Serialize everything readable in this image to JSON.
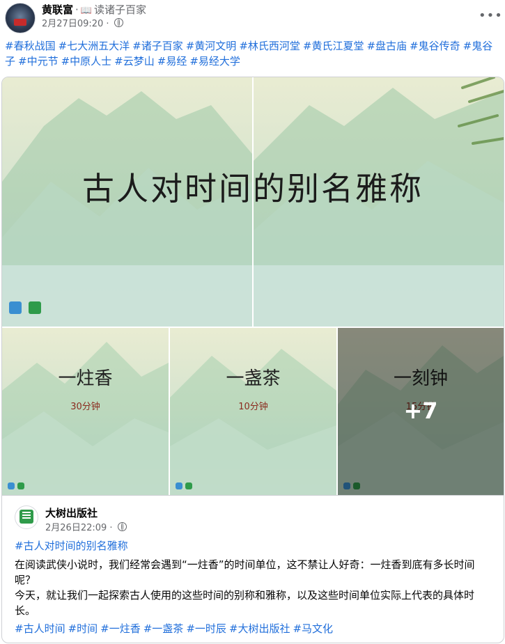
{
  "post": {
    "author": "黄联富",
    "separator": "·",
    "group_icon": "📖",
    "group": "读诸子百家",
    "timestamp": "2月27日09:20",
    "timestamp_sep": "·",
    "more_label": "•••",
    "hashtags": [
      "#春秋战国",
      "#七大洲五大洋",
      "#诸子百家",
      "#黄河文明",
      "#林氏西河堂",
      "#黄氏江夏堂",
      "#盘古庙",
      "#鬼谷传奇",
      "#鬼谷子",
      "#中元节",
      "#中原人士",
      "#云梦山",
      "#易经",
      "#易经大学"
    ]
  },
  "gallery": {
    "main_title": "古人对时间的别名雅称",
    "tiles": [
      {
        "title": "一炷香",
        "sub": "30分钟"
      },
      {
        "title": "一盏茶",
        "sub": "10分钟"
      },
      {
        "title": "一刻钟",
        "sub": "15分钟"
      }
    ],
    "more_count": "+7"
  },
  "shared": {
    "name": "大树出版社",
    "timestamp": "2月26日22:09",
    "timestamp_sep": "·",
    "headline_tag": "#古人对时间的别名雅称",
    "body_1": "在阅读武侠小说时，我们经常会遇到“一炷香”的时间单位，这不禁让人好奇：一炷香到底有多长时间呢？",
    "body_2": "今天，就让我们一起探索古人使用的这些时间的别称和雅称，以及这些时间单位实际上代表的具体时长。",
    "hashtags": [
      "#古人时间",
      "#时间",
      "#一炷香",
      "#一盏茶",
      "#一时辰",
      "#大树出版社",
      "#马文化"
    ]
  },
  "icons": [
    "avatar",
    "book-icon",
    "globe-icon",
    "more-icon",
    "mountain-background",
    "bamboo-icon",
    "publisher-logo"
  ]
}
